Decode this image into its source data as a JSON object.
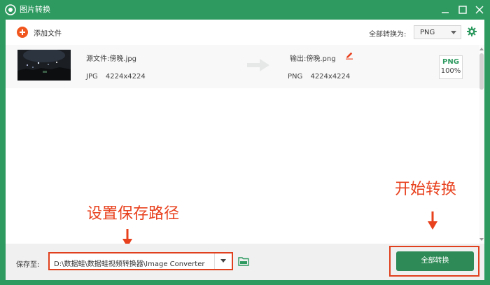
{
  "window": {
    "title": "图片转换"
  },
  "toolbar": {
    "add_label": "添加文件",
    "convert_all_label": "全部转换为:",
    "format_selected": "PNG"
  },
  "file": {
    "source_label": "源文件:傍晚.jpg",
    "source_format": "JPG",
    "source_dims": "4224x4224",
    "output_label": "输出:傍晚.png",
    "output_format": "PNG",
    "output_dims": "4224x4224",
    "badge_format": "PNG",
    "progress": "100%"
  },
  "annotations": {
    "start_hint": "开始转换",
    "path_hint": "设置保存路径"
  },
  "footer": {
    "save_label": "保存至:",
    "save_path": "D:\\数据蛙\\数据蛙视频转换器\\Image Converter",
    "convert_button": "全部转换"
  },
  "colors": {
    "brand_green": "#2e9a60",
    "button_green": "#2e8b57",
    "annotation_red": "#e0401d",
    "add_orange": "#f0561e"
  }
}
